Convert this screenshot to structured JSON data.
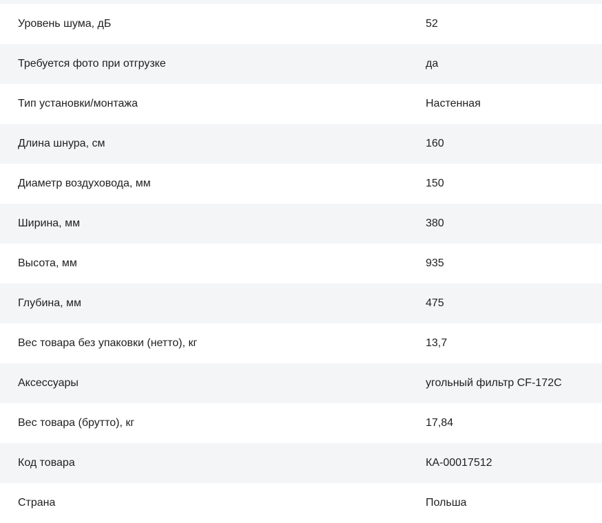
{
  "specs": [
    {
      "label": "Уровень шума, дБ",
      "value": "52"
    },
    {
      "label": "Требуется фото при отгрузке",
      "value": "да"
    },
    {
      "label": "Тип установки/монтажа",
      "value": "Настенная"
    },
    {
      "label": "Длина шнура, см",
      "value": "160"
    },
    {
      "label": "Диаметр воздуховода, мм",
      "value": "150"
    },
    {
      "label": "Ширина, мм",
      "value": "380"
    },
    {
      "label": "Высота, мм",
      "value": "935"
    },
    {
      "label": "Глубина, мм",
      "value": "475"
    },
    {
      "label": "Вес товара без упаковки (нетто), кг",
      "value": "13,7"
    },
    {
      "label": "Аксессуары",
      "value": "угольный фильтр CF-172C"
    },
    {
      "label": "Вес товара (брутто), кг",
      "value": "17,84"
    },
    {
      "label": "Код товара",
      "value": "КА-00017512"
    },
    {
      "label": "Страна",
      "value": "Польша"
    }
  ],
  "colors": {
    "row_shade": "#f4f5f7",
    "text": "#1f1f1f"
  }
}
